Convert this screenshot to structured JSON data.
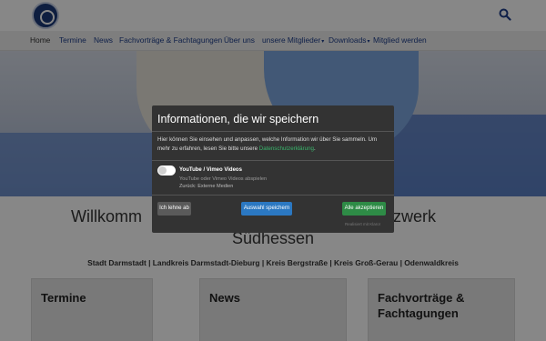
{
  "header": {
    "logo_icon": "club-seal-logo",
    "search_icon": "search-icon",
    "accent": "#1d3d8a"
  },
  "nav": {
    "items": [
      {
        "label": "Home",
        "active": true
      },
      {
        "label": "Termine"
      },
      {
        "label": "News"
      },
      {
        "label": "Fachvorträge & Fachtagungen"
      },
      {
        "label": "Über uns"
      },
      {
        "label": "unsere Mitglieder",
        "caret": "▾"
      },
      {
        "label": "Downloads",
        "caret": "▾"
      },
      {
        "label": "Mitglied werden"
      }
    ]
  },
  "hero": {
    "image": "gloved-hands-forming-heart"
  },
  "welcome": {
    "line1_left": "Willkomm",
    "line1_right": "E-Netzwerk",
    "line2": "Südhessen"
  },
  "regions": "Stadt Darmstadt | Landkreis Darmstadt-Dieburg | Kreis Bergstraße | Kreis Groß-Gerau | Odenwaldkreis",
  "cards": [
    {
      "title": "Termine"
    },
    {
      "title": "News"
    },
    {
      "title_line1": "Fachvorträge &",
      "title_line2": "Fachtagungen"
    }
  ],
  "consent": {
    "title": "Informationen, die wir speichern",
    "text": "Hier können Sie einsehen und anpassen, welche Information wir über Sie sammeln. Um mehr zu erfahren, lesen Sie bitte unsere",
    "link": "Datenschutzerklärung",
    "text_end": ".",
    "service": {
      "title": "YouTube / Vimeo Videos",
      "description": "YouTube oder Vimeo Videos abspielen",
      "back": "Zurück: Externe Medien"
    },
    "buttons": {
      "decline": "Ich lehne ab",
      "save": "Auswahl speichern",
      "accept": "Alle akzeptieren"
    },
    "footer": "Realisiert mit Klaro!",
    "colors": {
      "accept": "#2e8b46",
      "save": "#2b78c2",
      "link": "#39b46b"
    }
  }
}
